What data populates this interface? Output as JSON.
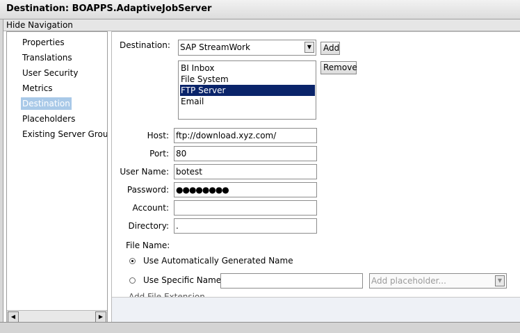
{
  "window": {
    "title": "Destination: BOAPPS.AdaptiveJobServer"
  },
  "nav": {
    "toggle_label": "Hide Navigation",
    "items": [
      {
        "label": "Properties"
      },
      {
        "label": "Translations"
      },
      {
        "label": "User Security"
      },
      {
        "label": "Metrics"
      },
      {
        "label": "Destination"
      },
      {
        "label": "Placeholders"
      },
      {
        "label": "Existing Server Groups"
      }
    ],
    "selected": "Destination"
  },
  "form": {
    "destination": {
      "label": "Destination:",
      "selected": "SAP StreamWork",
      "add_label": "Add",
      "remove_label": "Remove",
      "list": [
        "BI Inbox",
        "File System",
        "FTP Server",
        "Email"
      ],
      "list_selected": "FTP Server"
    },
    "host": {
      "label": "Host:",
      "value": "ftp://download.xyz.com/"
    },
    "port": {
      "label": "Port:",
      "value": "80"
    },
    "user_name": {
      "label": "User Name:",
      "value": "botest"
    },
    "password": {
      "label": "Password:",
      "value": "●●●●●●●●"
    },
    "account": {
      "label": "Account:",
      "value": ""
    },
    "directory": {
      "label": "Directory:",
      "value": "."
    },
    "file_name": {
      "label": "File Name:",
      "option_auto": "Use Automatically Generated Name",
      "option_specific": "Use Specific Name",
      "selected": "auto",
      "specific_value": "",
      "placeholder_dropdown": "Add placeholder...",
      "add_extension": "Add File Extension"
    }
  },
  "icons": {
    "dropdown": "chevron-down-icon",
    "scroll_left": "arrow-left-icon",
    "scroll_right": "arrow-right-icon"
  },
  "colors": {
    "nav_selected": "#a9c9e8",
    "list_selected": "#0a246a"
  }
}
